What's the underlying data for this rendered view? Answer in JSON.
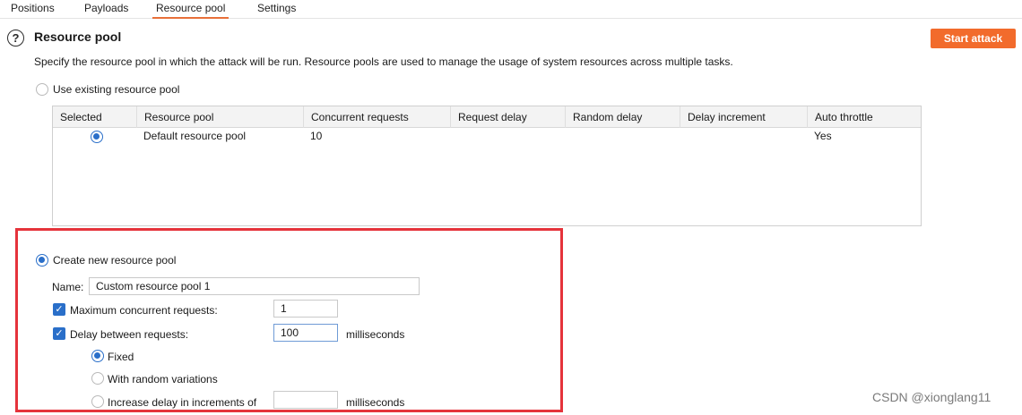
{
  "tabs": [
    "Positions",
    "Payloads",
    "Resource pool",
    "Settings"
  ],
  "header": {
    "help_icon": "?",
    "title": "Resource pool",
    "description": "Specify the resource pool in which the attack will be run. Resource pools are used to manage the usage of system resources across multiple tasks.",
    "start_attack_label": "Start attack"
  },
  "existing_pool": {
    "label": "Use existing resource pool",
    "selected": false,
    "table": {
      "columns": [
        "Selected",
        "Resource pool",
        "Concurrent requests",
        "Request delay",
        "Random delay",
        "Delay increment",
        "Auto throttle"
      ],
      "rows": [
        {
          "selected": true,
          "resource_pool": "Default resource pool",
          "concurrent_requests": "10",
          "request_delay": "",
          "random_delay": "",
          "delay_increment": "",
          "auto_throttle": "Yes"
        }
      ]
    }
  },
  "new_pool": {
    "label": "Create new resource pool",
    "selected": true,
    "name_label": "Name:",
    "name_value": "Custom resource pool 1",
    "max_concurrent": {
      "checked": true,
      "label": "Maximum concurrent requests:",
      "value": "1"
    },
    "delay": {
      "checked": true,
      "label": "Delay between requests:",
      "value": "100",
      "unit": "milliseconds"
    },
    "delay_modes": {
      "fixed": {
        "label": "Fixed",
        "selected": true
      },
      "random": {
        "label": "With random variations",
        "selected": false
      },
      "increment": {
        "label": "Increase delay in increments of",
        "selected": false,
        "value": "",
        "unit": "milliseconds"
      }
    }
  },
  "check_glyph": "✓",
  "watermark": "CSDN @xionglang11",
  "colors": {
    "accent": "#f26b2c",
    "tab_underline": "#e8703a",
    "radio_blue": "#2a6fc9",
    "highlight_red": "#e5333b"
  }
}
